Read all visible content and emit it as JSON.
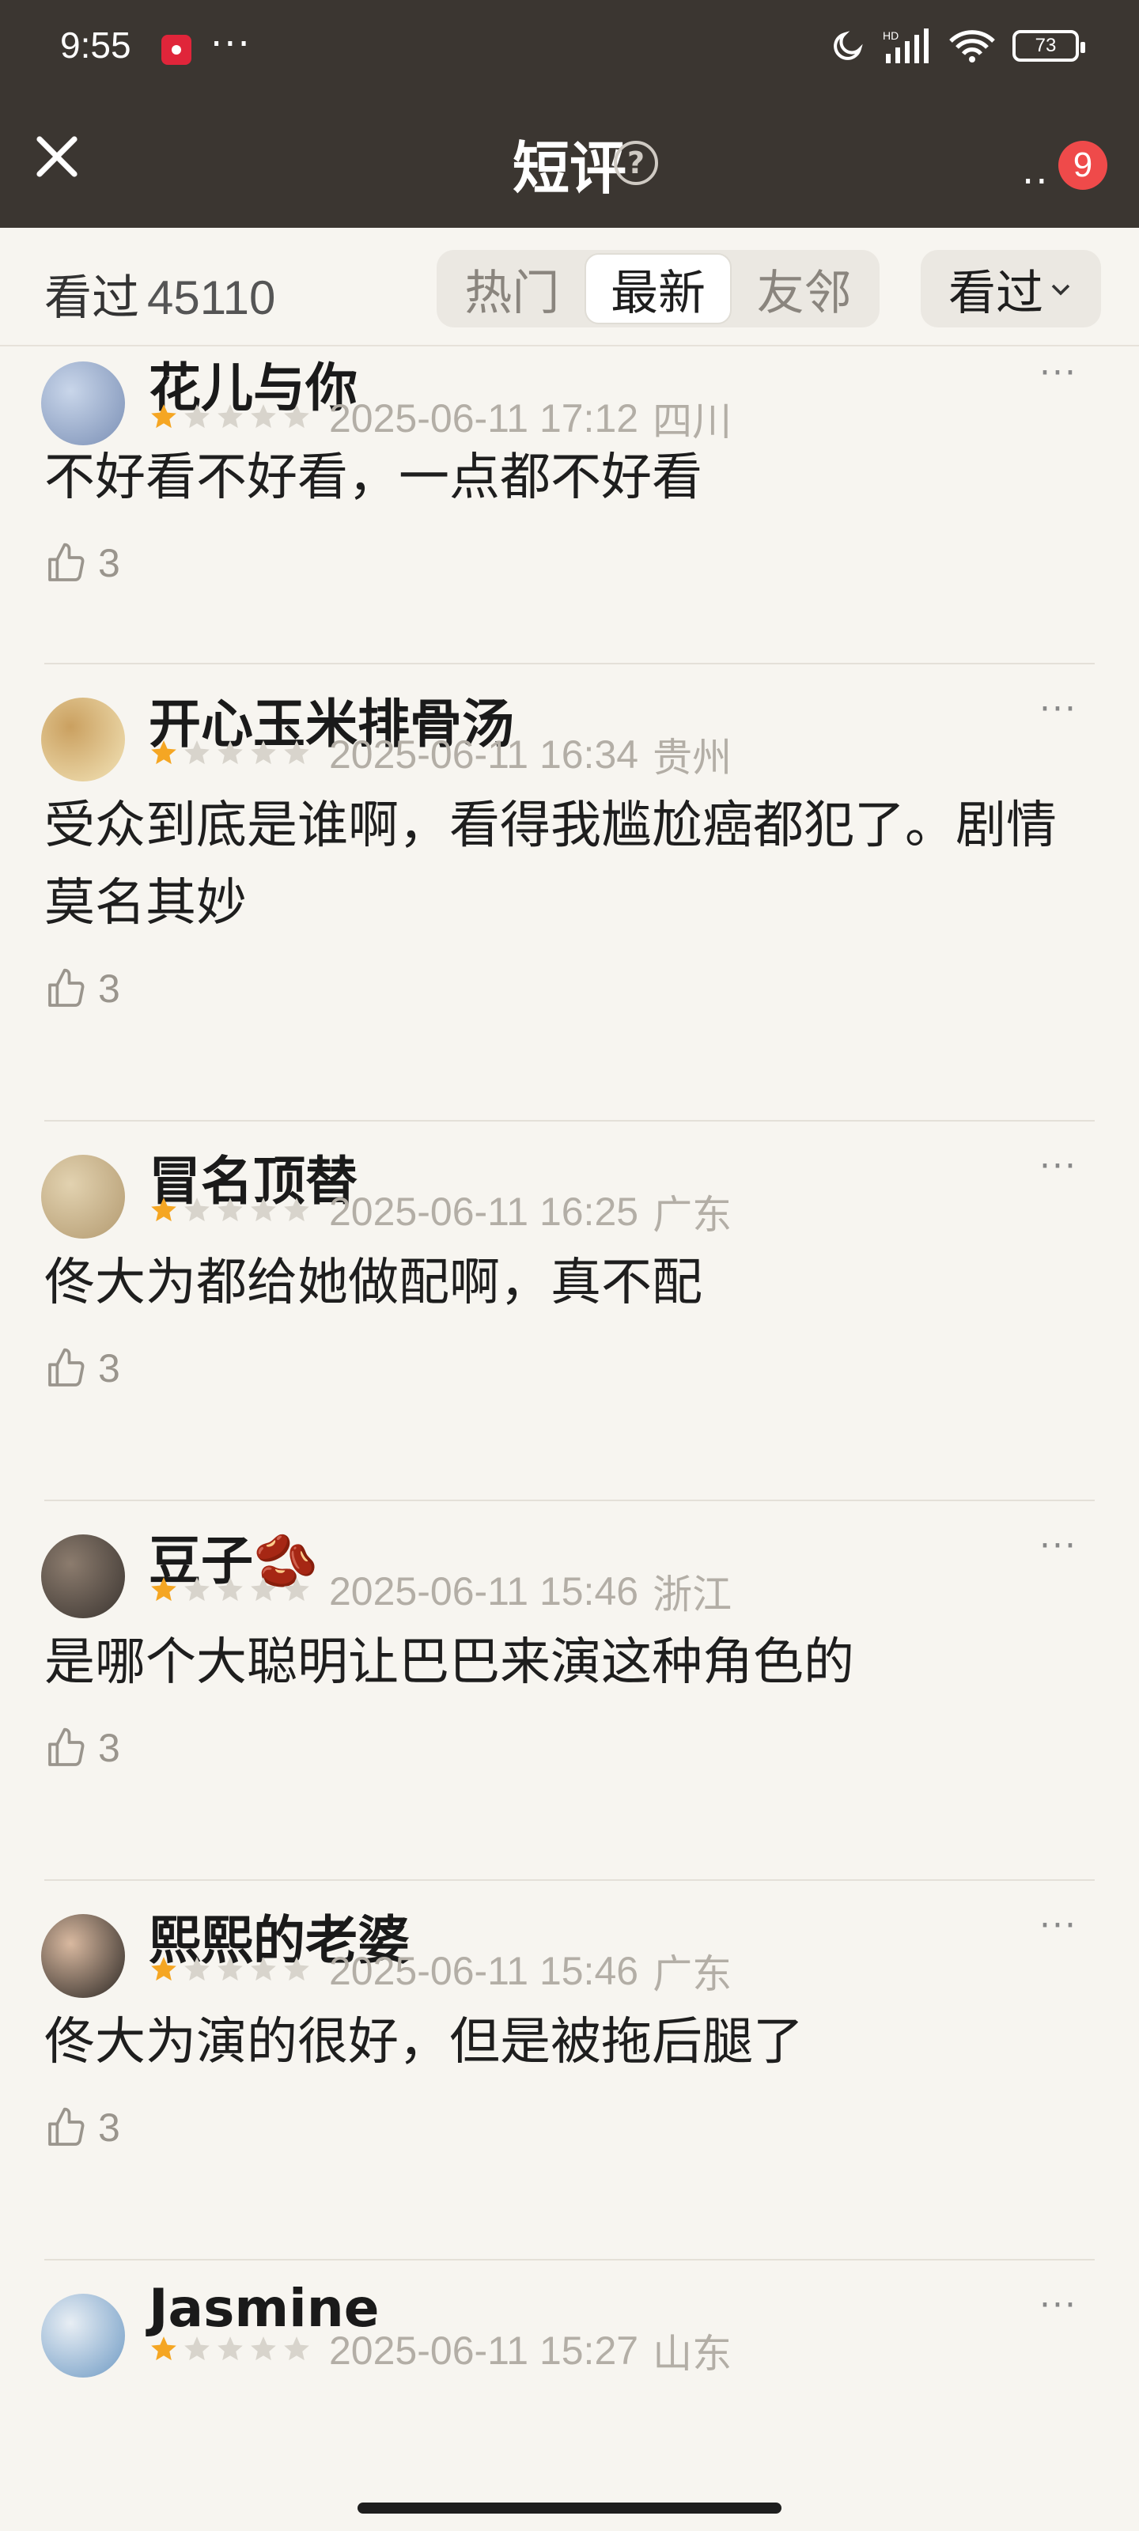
{
  "status_bar": {
    "time": "9:55",
    "battery": "73"
  },
  "header": {
    "title": "短评",
    "help_icon": "question-circle-icon",
    "badge_count": "9"
  },
  "filter": {
    "count_label": "看过",
    "count_value": "45110",
    "tabs": [
      "热门",
      "最新",
      "友邻"
    ],
    "active_tab": "最新",
    "sort_label": "看过"
  },
  "reviews": [
    {
      "user": "花儿与你",
      "rating": 1,
      "date": "2025-06-11 17:12",
      "region": "四川",
      "content": "不好看不好看，一点都不好看",
      "likes": "3"
    },
    {
      "user": "开心玉米排骨汤",
      "rating": 1,
      "date": "2025-06-11 16:34",
      "region": "贵州",
      "content": "受众到底是谁啊，看得我尴尬癌都犯了。剧情莫名其妙",
      "likes": "3"
    },
    {
      "user": "冒名顶替",
      "rating": 1,
      "date": "2025-06-11 16:25",
      "region": "广东",
      "content": "佟大为都给她做配啊，真不配",
      "likes": "3"
    },
    {
      "user": "豆子🫘",
      "rating": 1,
      "date": "2025-06-11 15:46",
      "region": "浙江",
      "content": "是哪个大聪明让巴巴来演这种角色的",
      "likes": "3"
    },
    {
      "user": "熙熙的老婆",
      "rating": 1,
      "date": "2025-06-11 15:46",
      "region": "广东",
      "content": "佟大为演的很好，但是被拖后腿了",
      "likes": "3"
    },
    {
      "user": "Jasmine",
      "rating": 1,
      "date": "2025-06-11 15:27",
      "region": "山东",
      "content": "",
      "likes": ""
    }
  ],
  "colors": {
    "header_bg": "#3b3631",
    "page_bg": "#f7f5f0",
    "star_on": "#f5a623",
    "star_off": "#d8d4cc",
    "badge": "#ef4a4a"
  }
}
